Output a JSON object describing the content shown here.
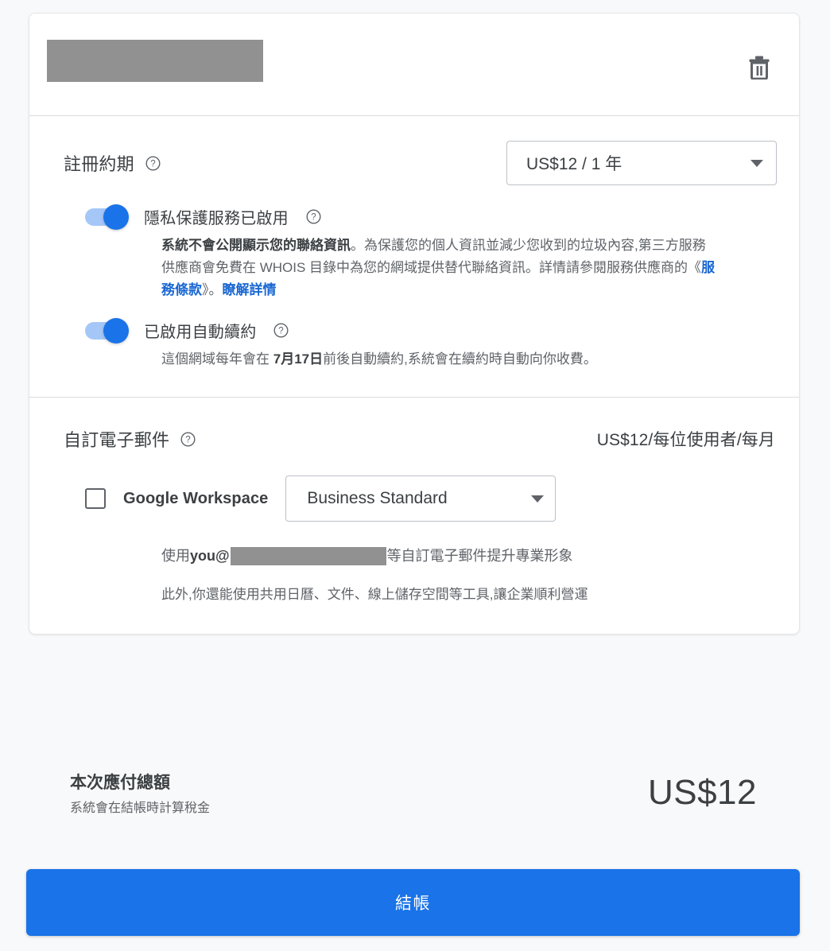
{
  "colors": {
    "accent": "#1a73e8",
    "link": "#1967d2",
    "page_background": "#f8f9fa",
    "card_background": "#ffffff",
    "divider": "#dadce0",
    "text_primary": "#3c4043",
    "text_secondary": "#5f6368",
    "redaction": "#919191",
    "toggle_track_on": "#a5c7f8"
  },
  "domain_header": {
    "domain_name_redacted": "",
    "delete_icon": "trash-icon"
  },
  "registration": {
    "label": "註冊約期",
    "help_icon": "help-circle-icon",
    "term_selected": "US$12 / 1 年",
    "term_caret_icon": "chevron-down-icon"
  },
  "privacy": {
    "toggle_state": "on",
    "label": "隱私保護服務已啟用",
    "help_icon": "help-circle-icon",
    "description_bold": "系統不會公開顯示您的聯絡資訊",
    "description_part1": "。為保護您的個人資訊並減少您收到的垃圾內容,第三方服務供應商會免費在 WHOIS 目錄中為您的網域提供替代聯絡資訊。詳情請參閱服務供應商的《",
    "terms_link": "服務條款",
    "description_part2": "》。",
    "learn_more_link": "瞭解詳情"
  },
  "auto_renew": {
    "toggle_state": "on",
    "label": "已啟用自動續約",
    "help_icon": "help-circle-icon",
    "description_part1": "這個網域每年會在 ",
    "renew_date_bold": "7月17日",
    "description_part2": "前後自動續約,系統會在續約時自動向你收費。"
  },
  "custom_email": {
    "label": "自訂電子郵件",
    "help_icon": "help-circle-icon",
    "price": "US$12/每位使用者/每月",
    "checkbox_state": "unchecked",
    "product_label": "Google Workspace",
    "plan_selected": "Business Standard",
    "plan_caret_icon": "chevron-down-icon",
    "note_part1": "使用 ",
    "note_bold": "you@",
    "note_domain_redacted": "",
    "note_part2": " 等自訂電子郵件提升專業形象",
    "note2": "此外,你還能使用共用日曆、文件、線上儲存空間等工具,讓企業順利營運"
  },
  "total": {
    "title": "本次應付總額",
    "subtitle": "系統會在結帳時計算稅金",
    "amount": "US$12"
  },
  "checkout": {
    "label": "結帳"
  }
}
